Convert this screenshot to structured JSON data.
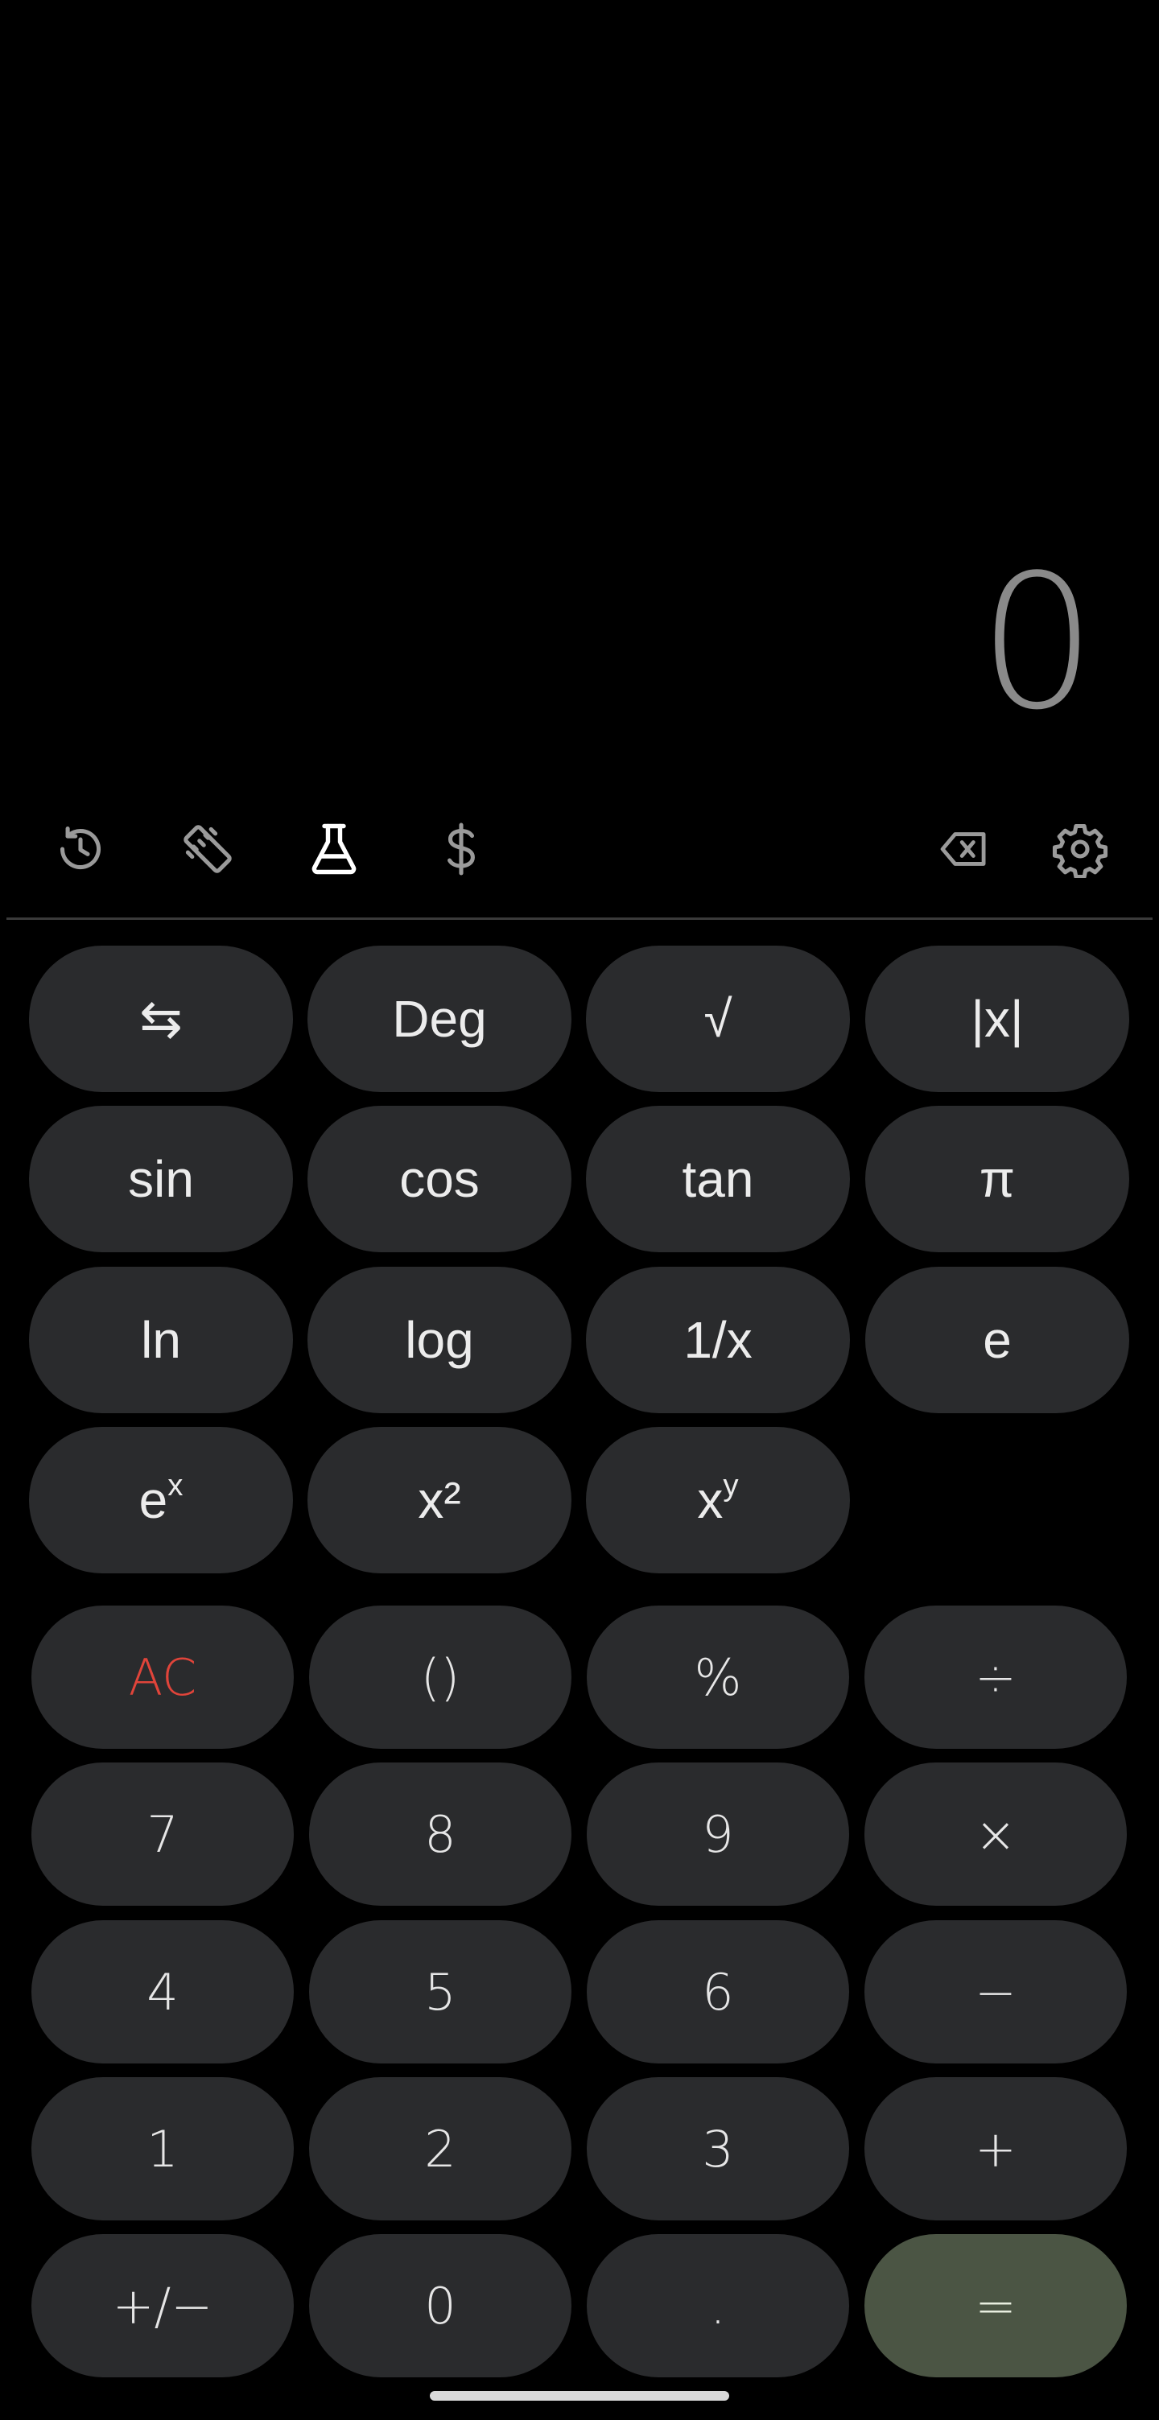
{
  "display": {
    "value": "0"
  },
  "toolbar": {
    "icons": [
      "history-icon",
      "ruler-icon",
      "flask-icon",
      "dollar-icon",
      "backspace-icon",
      "gear-icon"
    ],
    "active": "flask-icon"
  },
  "scientific": {
    "swap": "⇆",
    "deg": "Deg",
    "sqrt": "√",
    "abs": "|x|",
    "sin": "sin",
    "cos": "cos",
    "tan": "tan",
    "pi": "π",
    "ln": "ln",
    "log": "log",
    "inv": "1/x",
    "e": "e",
    "ex_base": "e",
    "ex_exp": "x",
    "sq": "x²",
    "xy_base": "x",
    "xy_exp": "y"
  },
  "keypad": {
    "ac": "AC",
    "paren": "()",
    "percent": "%",
    "divide": "÷",
    "seven": "7",
    "eight": "8",
    "nine": "9",
    "multiply": "×",
    "four": "4",
    "five": "5",
    "six": "6",
    "minus": "−",
    "one": "1",
    "two": "2",
    "three": "3",
    "plus": "+",
    "negate": "+/−",
    "zero": "0",
    "dot": ".",
    "equals": "="
  },
  "colors": {
    "background": "#000000",
    "button": "#2a2b2d",
    "equals": "#4b5544",
    "clear_text": "#e0443a",
    "display_text": "#8a8a8a"
  }
}
